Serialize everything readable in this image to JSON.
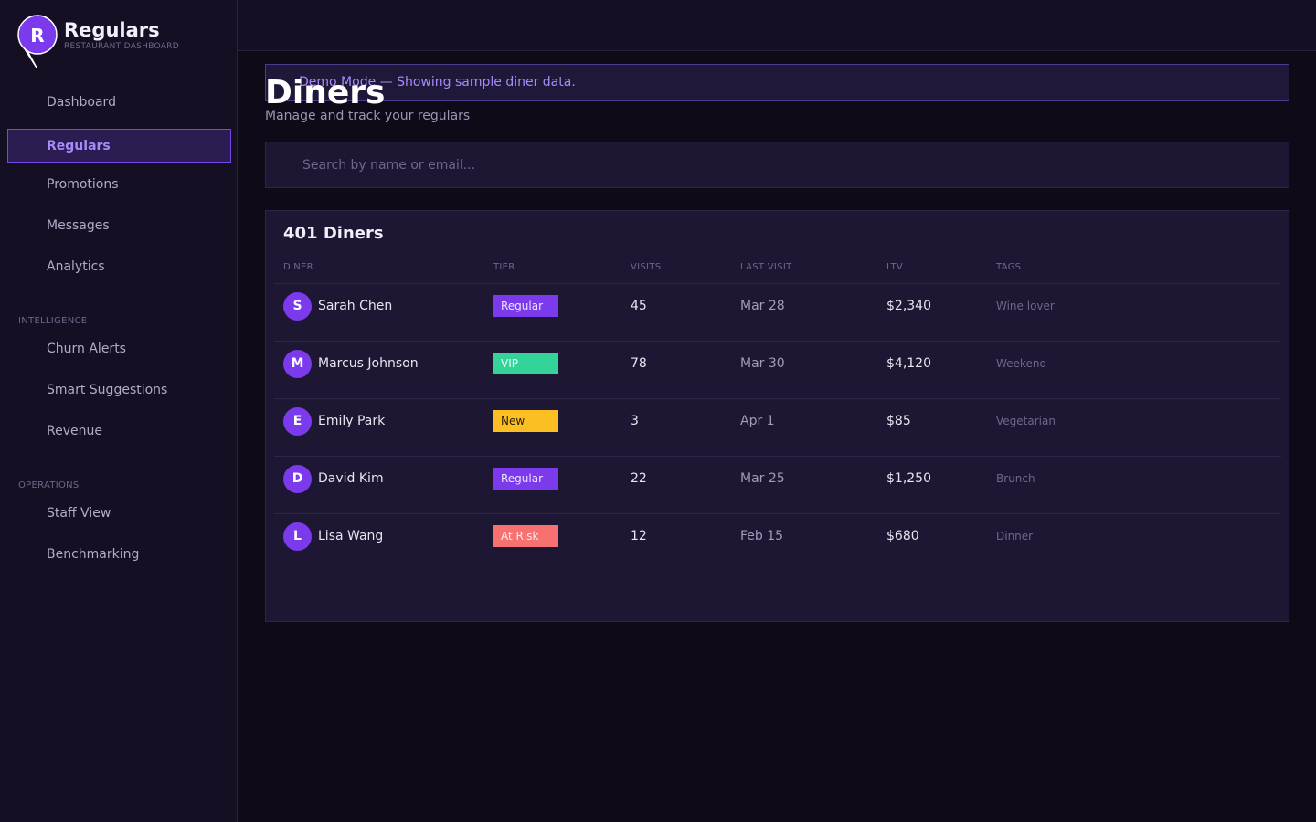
{
  "brand": {
    "initial": "R",
    "name": "Regulars",
    "subtitle": "RESTAURANT DASHBOARD",
    "accent": "#7c3aed"
  },
  "sidebar": {
    "main": [
      "Dashboard",
      "Regulars",
      "Promotions",
      "Messages",
      "Analytics"
    ],
    "active": "Regulars",
    "intelligence_heading": "INTELLIGENCE",
    "intelligence": [
      "Churn Alerts",
      "Smart Suggestions",
      "Revenue"
    ],
    "operations_heading": "OPERATIONS",
    "operations": [
      "Staff View",
      "Benchmarking"
    ]
  },
  "banner": {
    "text": "Demo Mode — Showing sample diner data."
  },
  "page": {
    "title": "Diners",
    "subtitle": "Manage and track your regulars"
  },
  "search": {
    "placeholder": "Search by name or email..."
  },
  "table": {
    "title": "401 Diners",
    "columns": [
      "DINER",
      "TIER",
      "VISITS",
      "LAST VISIT",
      "LTV",
      "TAGS"
    ],
    "rows": [
      {
        "initial": "S",
        "name": "Sarah Chen",
        "tier": "Regular",
        "visits": "45",
        "last_visit": "Mar 28",
        "ltv": "$2,340",
        "tags": "Wine lover"
      },
      {
        "initial": "M",
        "name": "Marcus Johnson",
        "tier": "VIP",
        "visits": "78",
        "last_visit": "Mar 30",
        "ltv": "$4,120",
        "tags": "Weekend"
      },
      {
        "initial": "E",
        "name": "Emily Park",
        "tier": "New",
        "visits": "3",
        "last_visit": "Apr 1",
        "ltv": "$85",
        "tags": "Vegetarian"
      },
      {
        "initial": "D",
        "name": "David Kim",
        "tier": "Regular",
        "visits": "22",
        "last_visit": "Mar 25",
        "ltv": "$1,250",
        "tags": "Brunch"
      },
      {
        "initial": "L",
        "name": "Lisa Wang",
        "tier": "At Risk",
        "visits": "12",
        "last_visit": "Feb 15",
        "ltv": "$680",
        "tags": "Dinner"
      }
    ]
  },
  "tier_colors": {
    "Regular": "#7c3aed",
    "VIP": "#34d399",
    "New": "#fbbf24",
    "At Risk": "#f87171"
  }
}
